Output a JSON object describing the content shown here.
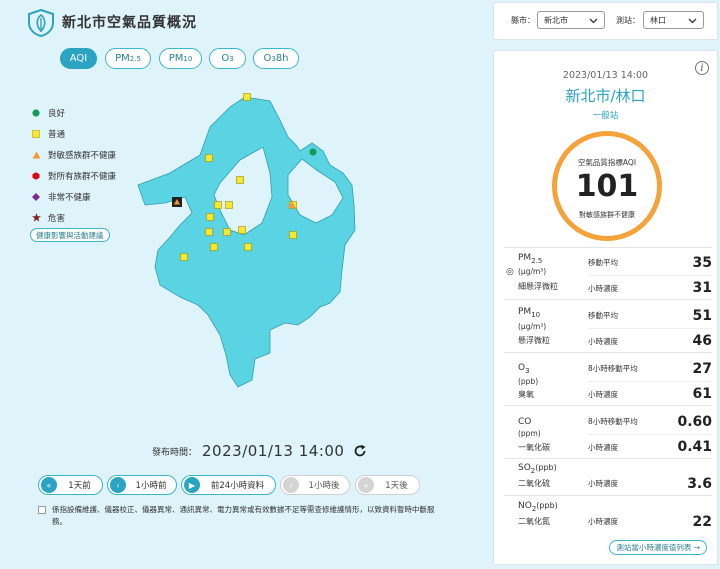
{
  "header": {
    "title": "新北市空氣品質概況"
  },
  "pollutant_tabs": [
    {
      "label": "AQI",
      "active": true
    },
    {
      "label": "PM",
      "sub": "2.5"
    },
    {
      "label": "PM",
      "sub": "10"
    },
    {
      "label": "O",
      "sub": "3"
    },
    {
      "label": "O",
      "sub": "3",
      "suffix": " 8h"
    }
  ],
  "legend": {
    "items": [
      {
        "label": "良好",
        "color": "#0f9d58",
        "shape": "circle"
      },
      {
        "label": "普通",
        "color": "#f6e830",
        "shape": "square"
      },
      {
        "label": "對敏感族群不健康",
        "color": "#f29b34",
        "shape": "triangle"
      },
      {
        "label": "對所有族群不健康",
        "color": "#d9001b",
        "shape": "hexagon"
      },
      {
        "label": "非常不健康",
        "color": "#7b2a8f",
        "shape": "diamond"
      },
      {
        "label": "危害",
        "color": "#7d1f24",
        "shape": "star"
      }
    ],
    "health_link": "健康影響與活動建議"
  },
  "publish": {
    "label": "發布時間：",
    "time": "2023/01/13 14:00"
  },
  "time_controls": [
    {
      "icon": "«",
      "label": "1天前",
      "enabled": true
    },
    {
      "icon": "‹",
      "label": "1小時前",
      "enabled": true
    },
    {
      "icon": "▶",
      "label": "前24小時資料",
      "enabled": true
    },
    {
      "icon": "›",
      "label": "1小時後",
      "enabled": false
    },
    {
      "icon": "»",
      "label": "1天後",
      "enabled": false
    }
  ],
  "notice": "係指設備維護、儀器校正、儀器異常、通訊異常、電力異常或有效數據不足等需查修維護情形，以致資料暫時中斷服務。",
  "selectors": {
    "county_label": "縣市：",
    "county_value": "新北市",
    "station_label": "測站：",
    "station_value": "林口"
  },
  "station": {
    "datetime": "2023/01/13 14:00",
    "name": "新北市/林口",
    "type": "一般站",
    "aqi_label": "空氣品質指標AQI",
    "aqi_value": "101",
    "aqi_status": "對敏感族群不健康",
    "aqi_color": "#f5a23b"
  },
  "pollutants": {
    "pm25": {
      "name": "PM",
      "sub": "2.5",
      "unit": "(μg/m³)",
      "mark": "◎",
      "cname": "細懸浮微粒",
      "r1_label": "移動平均",
      "r1_value": "35",
      "r2_label": "小時濃度",
      "r2_value": "31"
    },
    "pm10": {
      "name": "PM",
      "sub": "10",
      "unit": "(μg/m³)",
      "cname": "懸浮微粒",
      "r1_label": "移動平均",
      "r1_value": "51",
      "r2_label": "小時濃度",
      "r2_value": "46"
    },
    "o3": {
      "name": "O",
      "sub": "3",
      "unit": "(ppb)",
      "cname": "臭氧",
      "r1_label": "8小時移動平均",
      "r1_value": "27",
      "r2_label": "小時濃度",
      "r2_value": "61"
    },
    "co": {
      "name": "CO",
      "unit": "(ppm)",
      "cname": "一氧化碳",
      "r1_label": "8小時移動平均",
      "r1_value": "0.60",
      "r2_label": "小時濃度",
      "r2_value": "0.41"
    },
    "so2": {
      "name": "SO",
      "sub": "2",
      "unit_inline": "(ppb)",
      "cname": "二氧化硫",
      "r1_label": "小時濃度",
      "r1_value": "3.6"
    },
    "no2": {
      "name": "NO",
      "sub": "2",
      "unit_inline": "(ppb)",
      "cname": "二氧化氮",
      "r1_label": "小時濃度",
      "r1_value": "22"
    }
  },
  "chart_link": "測站當小時濃度值列表 →",
  "map": {
    "fill_color": "#5ad3e3",
    "stations": [
      {
        "status": "good"
      },
      {
        "status": "moderate"
      },
      {
        "status": "moderate"
      },
      {
        "status": "moderate"
      },
      {
        "status": "moderate"
      },
      {
        "status": "moderate"
      },
      {
        "status": "moderate"
      },
      {
        "status": "moderate"
      },
      {
        "status": "moderate"
      },
      {
        "status": "moderate"
      },
      {
        "status": "moderate"
      },
      {
        "status": "moderate"
      },
      {
        "status": "moderate"
      },
      {
        "status": "moderate"
      },
      {
        "status": "moderate"
      },
      {
        "status": "sensitive"
      },
      {
        "status": "selected-sensitive"
      }
    ]
  }
}
